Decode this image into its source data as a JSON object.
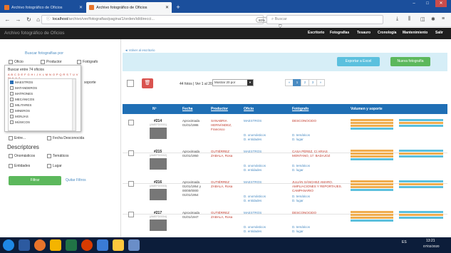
{
  "browser": {
    "tabs": [
      {
        "label": "Archivo fotográfico de Oficios"
      },
      {
        "label": "Archivo fotográfico de Oficios"
      }
    ],
    "url_host": "localhost",
    "url_path": "/archivo/ver/fotografias/pagina/1/orden/id/direcci...",
    "zoom": "80%",
    "search_placeholder": "Buscar"
  },
  "app": {
    "title": "Archivo fotográfico de Oficios",
    "menu": [
      "Escritorio",
      "Fotografías",
      "Tesauro",
      "Cronología",
      "Mantenimiento",
      "Salir"
    ]
  },
  "left": {
    "search_title": "Buscar fotografías por",
    "top_checks": [
      "Oficio",
      "Productor",
      "Fotógrafo"
    ],
    "dropdown_title": "Buscar entre 74 oficios",
    "letters": "A B C D E F G H I J K L M N O P Q R S T U V W X Y Z",
    "dropdown_items": [
      {
        "label": "MAESTROS",
        "checked": true
      },
      {
        "label": "MATANDEROS",
        "checked": false
      },
      {
        "label": "MATRONES",
        "checked": false
      },
      {
        "label": "MECÁNICOS",
        "checked": false
      },
      {
        "label": "MILITARES",
        "checked": false
      },
      {
        "label": "MINEROS",
        "checked": false
      },
      {
        "label": "MONJAS",
        "checked": false
      },
      {
        "label": "MÚSICOS",
        "checked": false
      }
    ],
    "side_label": "soporte",
    "mid_checks": [
      "Entre...",
      "Fecha Desconocida"
    ],
    "descriptores_title": "Descriptores",
    "desc_checks": [
      "Onomásticos",
      "Temáticos",
      "Entidades",
      "Lugar"
    ],
    "filter_btn": "Filtrar",
    "clear_link": "Quitar Filtros"
  },
  "main": {
    "back_link": "Volver al escritorio",
    "excel_btn": "Exportar a Excel",
    "new_btn": "Nueva fotografía",
    "summary": "44 fotos | Ver 1 al 20",
    "perpage": "Mostrar 20 por",
    "pages": [
      "«",
      "1",
      "2",
      "3",
      "»"
    ],
    "headers": [
      "Nº",
      "Fecha",
      "Productor",
      "Oficio",
      "Fotógrafo",
      "Volumen y soporte"
    ],
    "rows": [
      {
        "num": "#214",
        "code": "(AMEFD0001)",
        "date": [
          "Aproximada",
          "01/01/1986"
        ],
        "producer": [
          "SANABRIA",
          "HERNÁNDEZ,",
          "Francisco"
        ],
        "oficio": "MAESTROS",
        "oficio_desc": [
          "D. onomásticos",
          "D. entidades"
        ],
        "fotografo": [
          "DESCONOCIDO"
        ],
        "fot_desc": [
          "D. temáticos",
          "D. lugar"
        ]
      },
      {
        "num": "#215",
        "code": "(AMEFD0002)",
        "date": [
          "Aproximada",
          "01/01/1950"
        ],
        "producer": [
          "GUTIÉRREZ",
          "ZABALA, Rosa"
        ],
        "oficio": "MAESTROS",
        "oficio_desc": [
          "D. onomásticos",
          "D. entidades"
        ],
        "fotografo": [
          "CASA PÉREZ, C/ ARIAS",
          "MONTANO, 17. BADAJOZ"
        ],
        "fot_desc": [
          "D. temáticos",
          "D. lugar"
        ]
      },
      {
        "num": "#216",
        "code": "(AMEFD0003)",
        "date": [
          "Aproximada",
          "01/01/1954 y",
          "00/00/0000",
          "01/01/1954"
        ],
        "producer": [
          "GUTIÉRREZ",
          "ZABALA, Rosa"
        ],
        "oficio": "MAESTROS",
        "oficio_desc": [
          "D. onomásticos",
          "D. entidades"
        ],
        "fotografo": [
          "JULIÁN SÁNCHEZ AMARO.",
          "AMPLIACIONES Y REPORTAJES.",
          "CAMPANARIO"
        ],
        "fot_desc": [
          "D. temáticos",
          "D. lugar"
        ]
      },
      {
        "num": "#217",
        "code": "(AMEFD0004)",
        "date": [
          "Aproximada",
          "01/01/1947"
        ],
        "producer": [
          "GUTIÉRREZ",
          "ZABALA, Rosa"
        ],
        "oficio": "MAESTROS",
        "oficio_desc": [
          "D. onomásticos",
          "D. entidades"
        ],
        "fotografo": [
          "DESCONOCIDO"
        ],
        "fot_desc": [
          "D. temáticos",
          "D. lugar"
        ]
      }
    ]
  },
  "taskbar": {
    "lang": "ES",
    "time": "13:21",
    "date": "07/02/2020"
  },
  "colors": {
    "accent": "#1f6fb5",
    "header_bg": "#1f1f1f",
    "excel": "#5bc0de",
    "success": "#5cb85c",
    "danger": "#d9534f",
    "tag_orange": "#f0ad4e",
    "tag_blue": "#5bc0de"
  }
}
